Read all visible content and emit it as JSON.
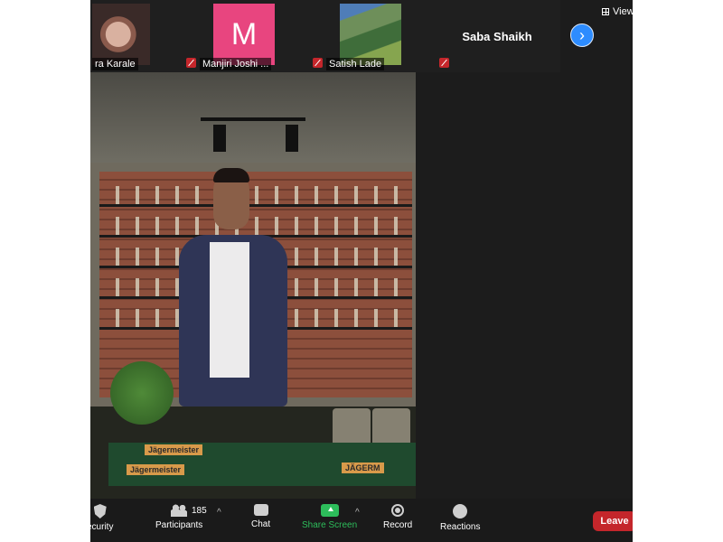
{
  "participants_strip": [
    {
      "name": "ra Karale",
      "muted": false,
      "type": "photo"
    },
    {
      "name": "Manjiri Joshi ...",
      "muted": true,
      "avatar_letter": "M",
      "type": "letter"
    },
    {
      "name": "Satish Lade",
      "muted": true,
      "type": "landscape"
    },
    {
      "name": "Saba Shaikh",
      "muted": true,
      "type": "name-only"
    }
  ],
  "view_button": {
    "label": "View"
  },
  "toolbar": {
    "security": "ecurity",
    "participants": "Participants",
    "participants_count": "185",
    "chat": "Chat",
    "share_screen": "Share Screen",
    "record": "Record",
    "reactions": "Reactions",
    "leave": "Leave"
  },
  "video_overlay": {
    "mat_text_1": "Jägermeister",
    "mat_text_2": "Jägermeister",
    "mat_text_3": "JÄGERM"
  },
  "colors": {
    "accent_blue": "#2d8cff",
    "share_green": "#2dbd5b",
    "leave_red": "#c4262b",
    "avatar_pink": "#e8457f"
  }
}
